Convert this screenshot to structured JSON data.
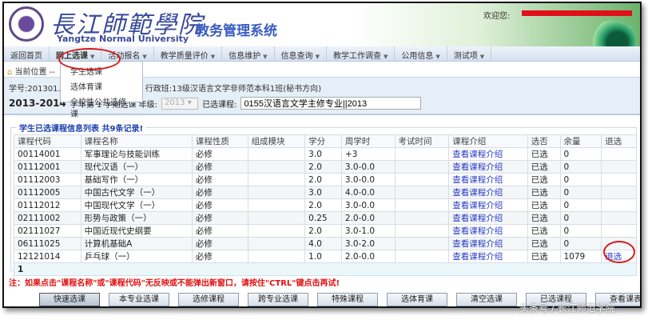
{
  "header": {
    "school_cn": "長江師範學院",
    "school_en": "Yangtze Normal University",
    "system_title": "教务管理系统",
    "welcome": "欢迎您:"
  },
  "nav": [
    {
      "label": "返回首页",
      "dropdown": false
    },
    {
      "label": "网上选课",
      "dropdown": true
    },
    {
      "label": "活动报名",
      "dropdown": true
    },
    {
      "label": "教学质量评价",
      "dropdown": true
    },
    {
      "label": "信息维护",
      "dropdown": true
    },
    {
      "label": "信息查询",
      "dropdown": true
    },
    {
      "label": "教学工作调查",
      "dropdown": true
    },
    {
      "label": "公用信息",
      "dropdown": true
    },
    {
      "label": "测试项",
      "dropdown": true
    }
  ],
  "dropdown": [
    "学生选课",
    "选体育课",
    "全校性公共选修课"
  ],
  "breadcrumb": "当前位置 --",
  "info": {
    "student_line": "学号:201301...   学院:文学与新闻学院  行政班:13级汉语言文学非师范本科1班(秘书方向)",
    "term": "2013-2014",
    "term_suffix": "学年第 1 学期选课 年级:",
    "grade": "2013",
    "selected_label": "已选课程:",
    "selected_value": "0155汉语言文学主修专业||2013"
  },
  "table": {
    "caption": "学生已选课程信息列表  共9条记录!",
    "headers": [
      "课程代码",
      "课程名称",
      "课程性质",
      "组成模块",
      "学分",
      "周学时",
      "考试时间",
      "课程介绍",
      "选否",
      "余量",
      "退选"
    ],
    "rows": [
      [
        "00114001",
        "军事理论与技能训练",
        "必修",
        "",
        "3.0",
        "+3",
        "",
        "查看课程介绍",
        "已选",
        "0",
        ""
      ],
      [
        "01112001",
        "现代汉语（一）",
        "必修",
        "",
        "2.0",
        "3.0-0.0",
        "",
        "查看课程介绍",
        "已选",
        "0",
        ""
      ],
      [
        "01112003",
        "基础写作（一）",
        "必修",
        "",
        "2.0",
        "3.0-0.0",
        "",
        "查看课程介绍",
        "已选",
        "0",
        ""
      ],
      [
        "01112005",
        "中国古代文学（一）",
        "必修",
        "",
        "3.0",
        "4.0-0.0",
        "",
        "查看课程介绍",
        "已选",
        "0",
        ""
      ],
      [
        "01112012",
        "中国现代文学（一）",
        "必修",
        "",
        "2.0",
        "3.0-0.0",
        "",
        "查看课程介绍",
        "已选",
        "0",
        ""
      ],
      [
        "02111002",
        "形势与政策（一）",
        "必修",
        "",
        "0.25",
        "2.0-0.0",
        "",
        "查看课程介绍",
        "已选",
        "0",
        ""
      ],
      [
        "02111027",
        "中国近现代史纲要",
        "必修",
        "",
        "2.0",
        "3.0-1.0",
        "",
        "查看课程介绍",
        "已选",
        "0",
        ""
      ],
      [
        "06111025",
        "计算机基础A",
        "必修",
        "",
        "4.0",
        "3.0-2.0",
        "",
        "查看课程介绍",
        "已选",
        "0",
        ""
      ],
      [
        "12121014",
        "乒乓球（一）",
        "必修",
        "",
        "1.0",
        "2.0-0.0",
        "",
        "查看课程介绍",
        "已选",
        "1079",
        "退选"
      ]
    ],
    "page": "1"
  },
  "note": "注：如果点击\"课程名称\"或\"课程代码\"无反映或不能弹出新窗口，请按住\"CTRL\"键点击再试!",
  "buttons": [
    "快速选课",
    "本专业选课",
    "选修课程",
    "跨专业选课",
    "特殊课程",
    "选体育课",
    "清空选课",
    "已选课程",
    "查看课表"
  ],
  "watermark": "头条号 / 长江师范学院"
}
